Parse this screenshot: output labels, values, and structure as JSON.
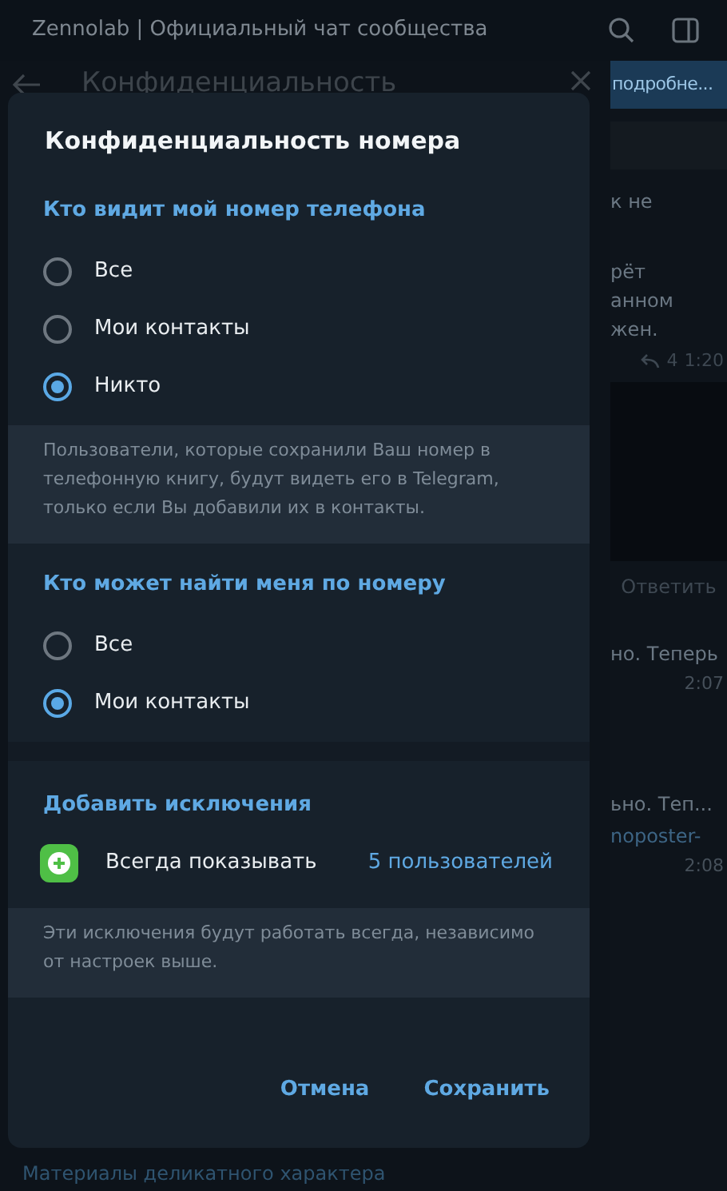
{
  "app_title": "Zennolab | Официальный чат сообщества",
  "panel_title": "Конфиденциальность",
  "chat": {
    "button": "подробне...",
    "fragments": [
      {
        "kind": "text",
        "text": "к не"
      },
      {
        "kind": "text",
        "text": "рёт"
      },
      {
        "kind": "text",
        "text": "анном"
      },
      {
        "kind": "text",
        "text": "жен."
      },
      {
        "kind": "meta",
        "count": "4",
        "time": "1:20"
      },
      {
        "kind": "media"
      },
      {
        "kind": "reply",
        "text": "Ответить"
      },
      {
        "kind": "text",
        "text": "но. Теперь"
      },
      {
        "kind": "time",
        "text": "2:07"
      },
      {
        "kind": "text",
        "text": "ьно. Теп..."
      },
      {
        "kind": "link",
        "text": "noposter-"
      },
      {
        "kind": "time",
        "text": "2:08"
      }
    ]
  },
  "dialog": {
    "title": "Конфиденциальность номера",
    "sections": [
      {
        "header": "Кто видит мой номер телефона",
        "options": [
          {
            "label": "Все",
            "selected": false
          },
          {
            "label": "Мои контакты",
            "selected": false
          },
          {
            "label": "Никто",
            "selected": true
          }
        ],
        "note": "Пользователи, которые сохранили Ваш номер в телефонную книгу, будут видеть его в Telegram, только если Вы добавили их в контакты."
      },
      {
        "header": "Кто может найти меня по номеру",
        "options": [
          {
            "label": "Все",
            "selected": false
          },
          {
            "label": "Мои контакты",
            "selected": true
          }
        ]
      }
    ],
    "exceptions": {
      "header": "Добавить исключения",
      "rows": [
        {
          "label": "Всегда показывать",
          "value": "5 пользователей"
        }
      ],
      "note": "Эти исключения будут работать всегда, независимо от настроек выше."
    },
    "buttons": [
      "Отмена",
      "Сохранить"
    ]
  },
  "background_item": "Материалы деликатного характера"
}
